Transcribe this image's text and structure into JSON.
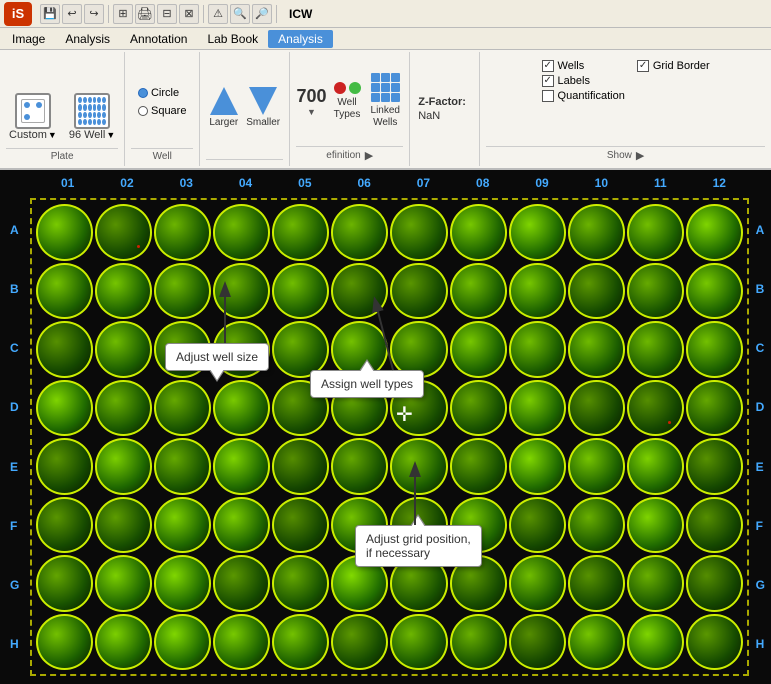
{
  "app": {
    "logo": "iS",
    "title": "ICW"
  },
  "toolbar_icons": {
    "save": "💾",
    "undo": "↩",
    "redo": "↪",
    "grid1": "⊞",
    "print": "🖨",
    "grid2": "⊟",
    "grid3": "⊠",
    "warning": "⚠",
    "search1": "🔍",
    "search2": "🔎"
  },
  "menu": {
    "items": [
      "Image",
      "Analysis",
      "Annotation",
      "Lab Book",
      "Analysis"
    ],
    "active_index": 4
  },
  "plate_section": {
    "label": "Plate",
    "custom_label": "Custom",
    "well96_label": "96 Well"
  },
  "well_section": {
    "label": "Well",
    "circle_label": "Circle",
    "square_label": "Square",
    "circle_checked": true
  },
  "size_section": {
    "larger_label": "Larger",
    "smaller_label": "Smaller"
  },
  "def_section": {
    "label": "Definition",
    "value_700": "700",
    "well_types_label": "Well\nTypes",
    "linked_wells_label": "Linked\nWells"
  },
  "zfactor": {
    "label": "Z-Factor:",
    "value": "NaN"
  },
  "show_section": {
    "label": "Show",
    "items": [
      {
        "label": "Wells",
        "checked": true
      },
      {
        "label": "Grid Border",
        "checked": true
      },
      {
        "label": "Labels",
        "checked": true
      },
      {
        "label": "Quantification",
        "checked": false
      }
    ]
  },
  "plate": {
    "col_labels": [
      "01",
      "02",
      "03",
      "04",
      "05",
      "06",
      "07",
      "08",
      "09",
      "10",
      "11",
      "12"
    ],
    "row_labels": [
      "A",
      "B",
      "C",
      "D",
      "E",
      "F",
      "G",
      "H"
    ]
  },
  "tooltips": {
    "well_size": "Adjust well size",
    "well_types": "Assign well types",
    "grid_position": "Adjust grid position,\nif necessary"
  }
}
